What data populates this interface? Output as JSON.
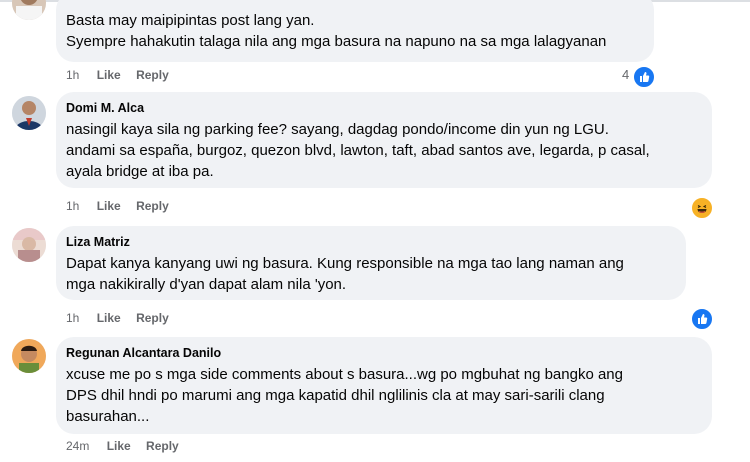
{
  "comments": [
    {
      "author": "",
      "lines": [
        "Basta may maipipintas post lang yan.",
        "Syempre hahakutin talaga nila ang mga basura na napuno na sa mga lalagyanan"
      ],
      "time": "1h",
      "like": "Like",
      "reply": "Reply",
      "reaction_count": "4",
      "reaction": "like-icon"
    },
    {
      "author": "Domi M. Alca",
      "lines": [
        "nasingil kaya sila ng parking fee? sayang, dagdag pondo/income din yun ng LGU.",
        "andami sa españa, burgoz, quezon blvd, lawton, taft, abad santos ave, legarda, p casal,",
        "ayala bridge at iba pa."
      ],
      "time": "1h",
      "like": "Like",
      "reply": "Reply",
      "reaction": "haha-icon"
    },
    {
      "author": "Liza Matriz",
      "lines": [
        "Dapat kanya kanyang uwi ng basura. Kung responsible na mga tao lang naman ang",
        "mga nakikirally d'yan dapat alam nila 'yon."
      ],
      "time": "1h",
      "like": "Like",
      "reply": "Reply",
      "reaction": "like-icon"
    },
    {
      "author": "Regunan Alcantara Danilo",
      "lines": [
        "xcuse me po s mga side comments about s basura...wg po mgbuhat ng bangko ang",
        "DPS dhil hndi po marumi ang mga kapatid dhil nglilinis cla at may sari-sarili clang",
        "basurahan..."
      ],
      "time": "24m",
      "like": "Like",
      "reply": "Reply"
    }
  ],
  "colors": {
    "bubble": "#f0f2f5",
    "meta": "#65676b",
    "like_blue": "#1877f2",
    "haha_yellow": "#f7b125"
  }
}
